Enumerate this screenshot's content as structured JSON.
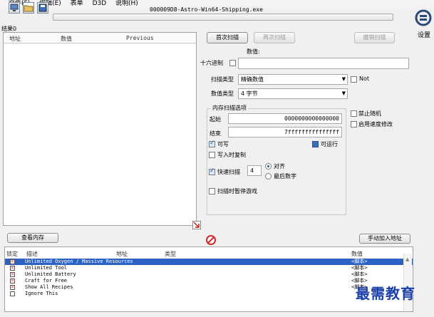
{
  "menu": [
    "文件(F)",
    "编辑(E)",
    "表单",
    "D3D",
    "说明(H)"
  ],
  "process_title": "000009D8-Astro-Win64-Shipping.exe",
  "results_count": "结果0",
  "settings_label": "设置",
  "results_columns": [
    "地址",
    "数值",
    "Previous"
  ],
  "buttons": {
    "first_scan": "首次扫描",
    "next_scan": "再次扫描",
    "undo_scan": "撤销扫描",
    "view_memory": "查看内存",
    "add_address": "手动加入地址"
  },
  "scan": {
    "value_label": "数值:",
    "hex_label": "十六进制",
    "scan_type_label": "扫描类型",
    "scan_type_value": "精确数值",
    "value_type_label": "数值类型",
    "value_type_value": "4 字节",
    "not_label": "Not",
    "memory_options_label": "内存扫描选项",
    "start_label": "起始",
    "start_value": "0000000000000000",
    "stop_label": "结束",
    "stop_value": "7fffffffffffffff",
    "writable_label": "可写",
    "executable_label": "可运行",
    "copy_on_write_label": "写入时复制",
    "fast_scan_label": "快速扫描",
    "fast_scan_value": "4",
    "alignment_label": "对齐",
    "last_digits_label": "最后数字",
    "pause_game_label": "扫描时暂停游戏",
    "disable_random_label": "禁止随机",
    "speedhack_label": "启用速度修改"
  },
  "cheat_table": {
    "columns": [
      "锁定",
      "描述",
      "地址",
      "类型",
      "数值"
    ],
    "rows": [
      {
        "description": "Unlimited Oxygen / Massive Resources",
        "value": "<脚本>",
        "selected": true
      },
      {
        "description": "Unlimited Tool",
        "value": "<脚本>",
        "selected": false
      },
      {
        "description": "Unlimited Battery",
        "value": "<脚本>",
        "selected": false
      },
      {
        "description": "Craft for Free",
        "value": "<脚本>",
        "selected": false
      },
      {
        "description": "Show All Recipes",
        "value": "<脚本>",
        "selected": false
      },
      {
        "description": "Ignore This",
        "value": "",
        "selected": false
      }
    ]
  },
  "watermark": "最需教育",
  "colors": {
    "selection": "#2b62c4",
    "watermark": "#1a3fa8",
    "stop_icon": "#d22b2b"
  }
}
